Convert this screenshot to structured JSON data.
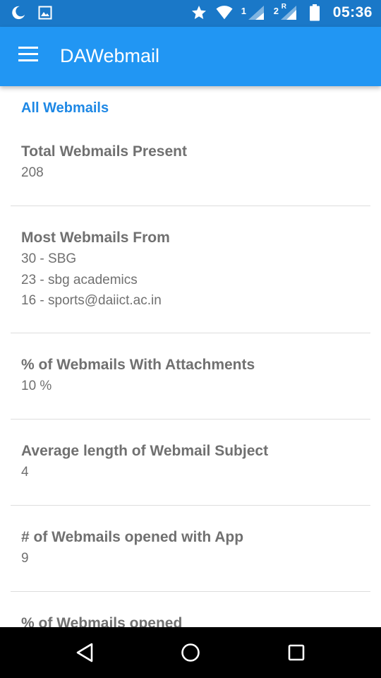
{
  "status_bar": {
    "time": "05:36",
    "sim1": "1",
    "sim2": "2",
    "sim2_roaming": "R",
    "icons": [
      "moon-icon",
      "image-icon",
      "star-icon",
      "wifi-icon",
      "signal-icon",
      "signal-icon",
      "battery-icon"
    ]
  },
  "app_bar": {
    "title": "DAWebmail",
    "menu_icon": "hamburger-menu-icon"
  },
  "content": {
    "section_header": "All Webmails",
    "stats": [
      {
        "title": "Total Webmails Present",
        "values": [
          "208"
        ]
      },
      {
        "title": "Most Webmails From",
        "values": [
          "30 - SBG",
          "23 - sbg academics",
          "16 - sports@daiict.ac.in"
        ]
      },
      {
        "title": "% of Webmails With Attachments",
        "values": [
          "10 %"
        ]
      },
      {
        "title": "Average length of Webmail Subject",
        "values": [
          "4"
        ]
      },
      {
        "title": "# of Webmails opened with App",
        "values": [
          "9"
        ]
      },
      {
        "title": "% of Webmails opened",
        "values": []
      }
    ]
  },
  "nav_bar": {
    "icons": [
      "back-icon",
      "home-icon",
      "recents-icon"
    ]
  }
}
